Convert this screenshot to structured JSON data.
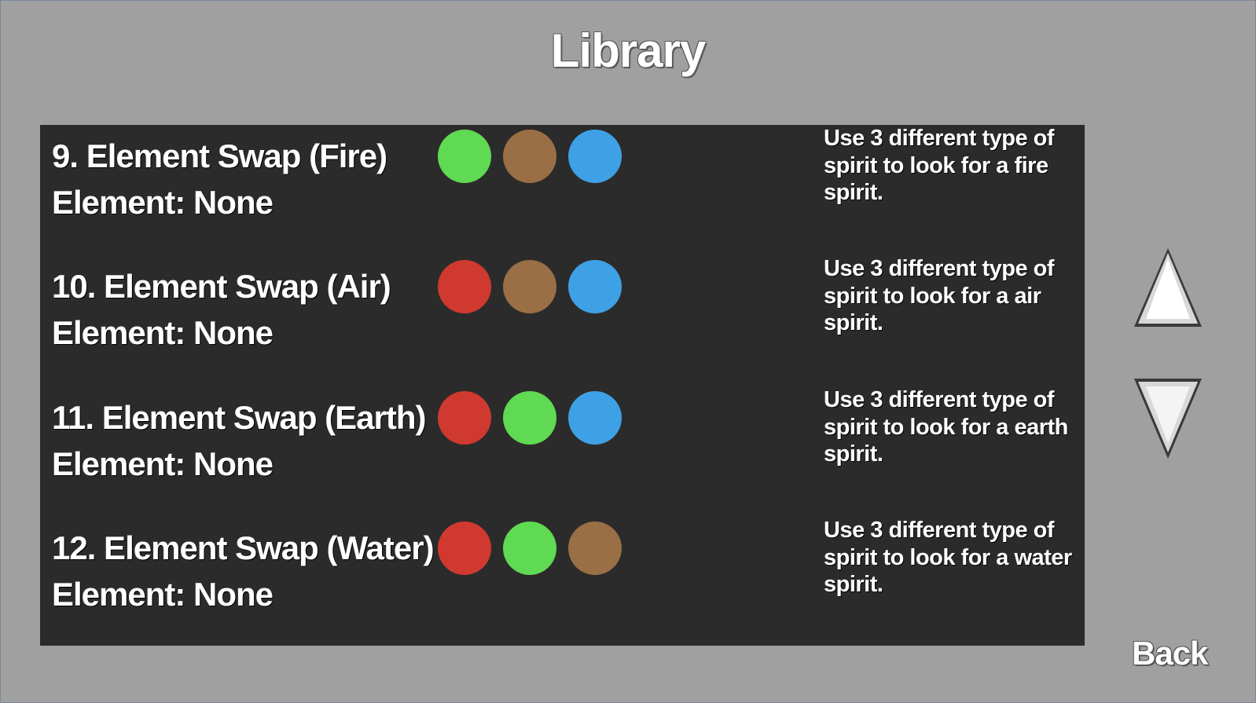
{
  "title": "Library",
  "colors": {
    "background": "#a0a0a0",
    "panel": "#2b2b2b",
    "fire": "#d0392f",
    "air": "#5fda52",
    "earth": "#9a6f45",
    "water": "#3fa1e5"
  },
  "entries": [
    {
      "name": "9. Element Swap (Fire)",
      "element": "Element: None",
      "spirits": [
        "air",
        "earth",
        "water"
      ],
      "description": "Use 3 different type of spirit to look for a fire spirit."
    },
    {
      "name": "10. Element Swap (Air)",
      "element": "Element: None",
      "spirits": [
        "fire",
        "earth",
        "water"
      ],
      "description": "Use 3 different type of spirit to look for a air spirit."
    },
    {
      "name": "11. Element Swap (Earth)",
      "element": "Element: None",
      "spirits": [
        "fire",
        "air",
        "water"
      ],
      "description": "Use 3 different type of spirit to look for a earth spirit."
    },
    {
      "name": "12. Element Swap (Water)",
      "element": "Element: None",
      "spirits": [
        "fire",
        "air",
        "earth"
      ],
      "description": "Use 3 different type of spirit to look for a water spirit."
    }
  ],
  "scroll_up_icon": "triangle-up-icon",
  "scroll_down_icon": "triangle-down-icon",
  "back_label": "Back"
}
